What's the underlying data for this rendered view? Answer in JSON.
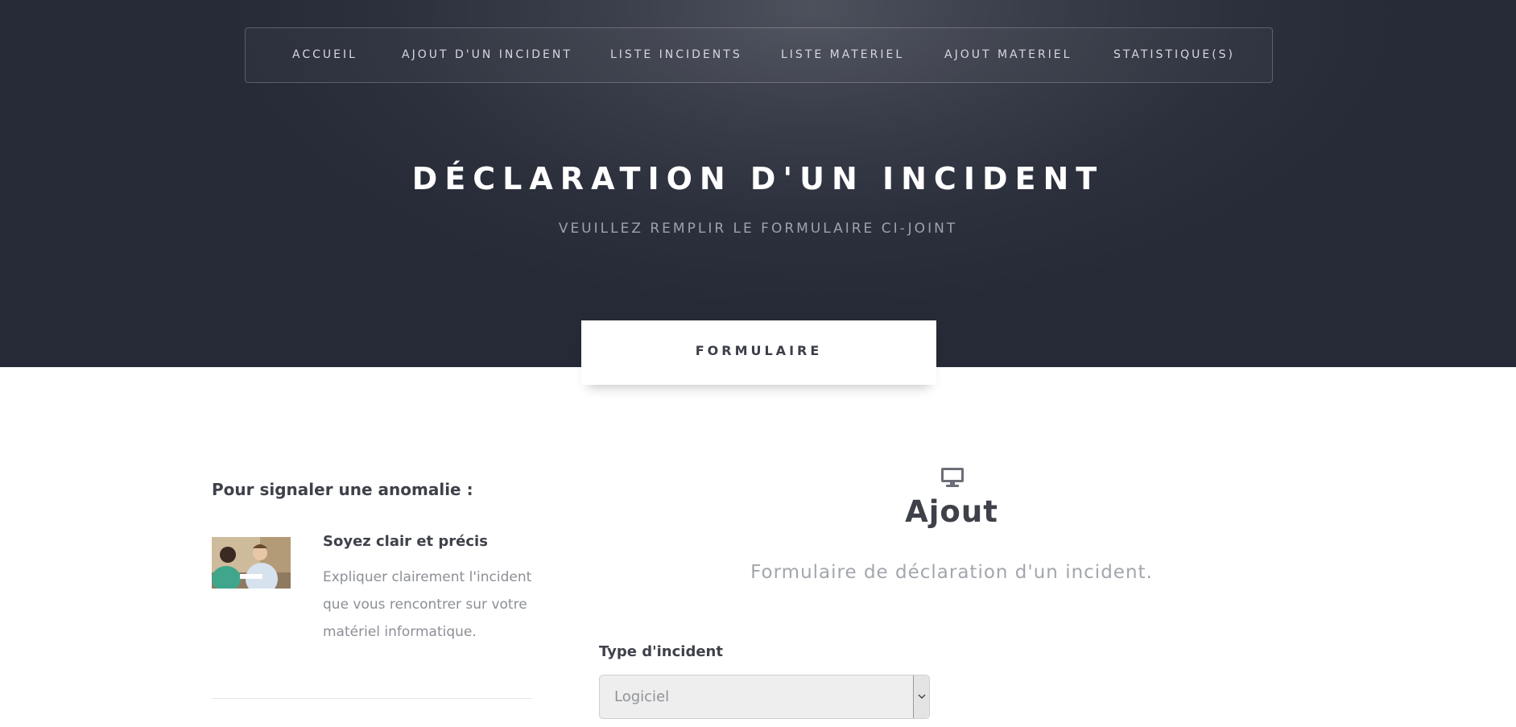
{
  "nav": {
    "items": [
      {
        "label": "ACCUEIL"
      },
      {
        "label": "AJOUT D'UN INCIDENT"
      },
      {
        "label": "LISTE INCIDENTS"
      },
      {
        "label": "LISTE MATERIEL"
      },
      {
        "label": "AJOUT MATERIEL"
      },
      {
        "label": "STATISTIQUE(S)"
      }
    ]
  },
  "hero": {
    "title": "DÉCLARATION D'UN INCIDENT",
    "subtitle": "VEUILLEZ REMPLIR LE FORMULAIRE CI-JOINT"
  },
  "tab": {
    "label": "FORMULAIRE"
  },
  "sidebar": {
    "heading": "Pour signaler une anomalie :",
    "item": {
      "title": "Soyez clair et précis",
      "text": "Expliquer clairement l'incident que vous rencontrer sur votre matériel informatique.",
      "image": "support-conversation-photo"
    }
  },
  "main": {
    "icon": "desktop-monitor-icon",
    "heading": "Ajout",
    "lead": "Formulaire de déclaration d'un incident.",
    "field_label": "Type d'incident",
    "select_value": "Logiciel"
  }
}
